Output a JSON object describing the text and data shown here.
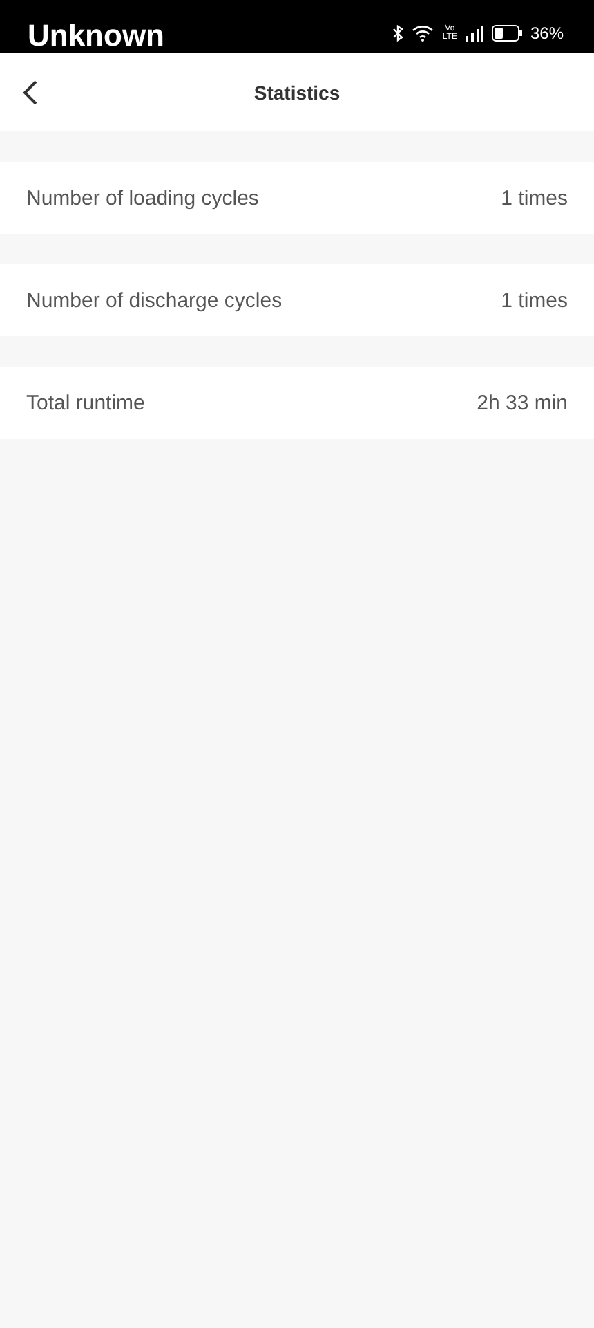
{
  "status_bar": {
    "label": "Unknown",
    "network": [
      "Vo",
      "LTE"
    ],
    "battery": "36%"
  },
  "header": {
    "title": "Statistics"
  },
  "rows": [
    {
      "label": "Number of loading cycles",
      "value": "1 times"
    },
    {
      "label": "Number of discharge cycles",
      "value": "1 times"
    },
    {
      "label": "Total runtime",
      "value": "2h 33 min"
    }
  ]
}
